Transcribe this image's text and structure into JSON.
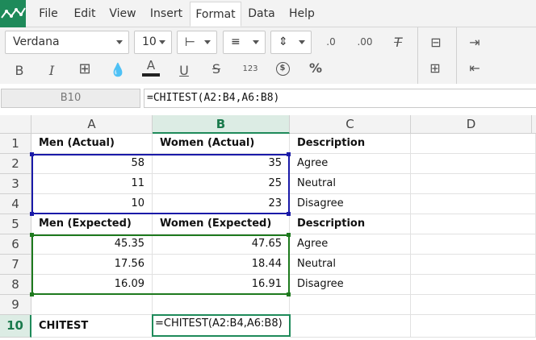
{
  "menu": {
    "items": [
      {
        "label": "File"
      },
      {
        "label": "Edit"
      },
      {
        "label": "View"
      },
      {
        "label": "Insert"
      },
      {
        "label": "Format",
        "active": true
      },
      {
        "label": "Data"
      },
      {
        "label": "Help"
      }
    ]
  },
  "toolbar": {
    "font_family": "Verdana",
    "font_size": "10",
    "bold_label": "B",
    "italic_label": "I",
    "font_color_label": "A",
    "underline_label": "U",
    "strikethrough_label": "S",
    "number_format_label": "123",
    "currency_label": "$",
    "percent_label": "%",
    "decimal_decrease_label": ".0",
    "decimal_increase_label": ".00",
    "clear_format_label": "T"
  },
  "formula_bar": {
    "cell_ref": "B10",
    "formula": "=CHITEST(A2:B4,A6:B8)"
  },
  "sheet": {
    "columns": [
      "A",
      "B",
      "C",
      "D"
    ],
    "rows": [
      "1",
      "2",
      "3",
      "4",
      "5",
      "6",
      "7",
      "8",
      "9",
      "10"
    ],
    "selected_column": "B",
    "selected_row": "10",
    "cells": {
      "A1": "Men (Actual)",
      "B1": "Women (Actual)",
      "C1": "Description",
      "A2": "58",
      "B2": "35",
      "C2": "Agree",
      "A3": "11",
      "B3": "25",
      "C3": "Neutral",
      "A4": "10",
      "B4": "23",
      "C4": "Disagree",
      "A5": "Men (Expected)",
      "B5": "Women (Expected)",
      "C5": "Description",
      "A6": "45.35",
      "B6": "47.65",
      "C6": "Agree",
      "A7": "17.56",
      "B7": "18.44",
      "C7": "Neutral",
      "A8": "16.09",
      "B8": "16.91",
      "C8": "Disagree",
      "A10": "CHITEST",
      "B10": "=CHITEST(A2:B4,A6:B8)"
    },
    "range_colors": {
      "actual": "#1a1aa8",
      "expected": "#1e7a1e",
      "active": "#1e8a5a"
    }
  }
}
